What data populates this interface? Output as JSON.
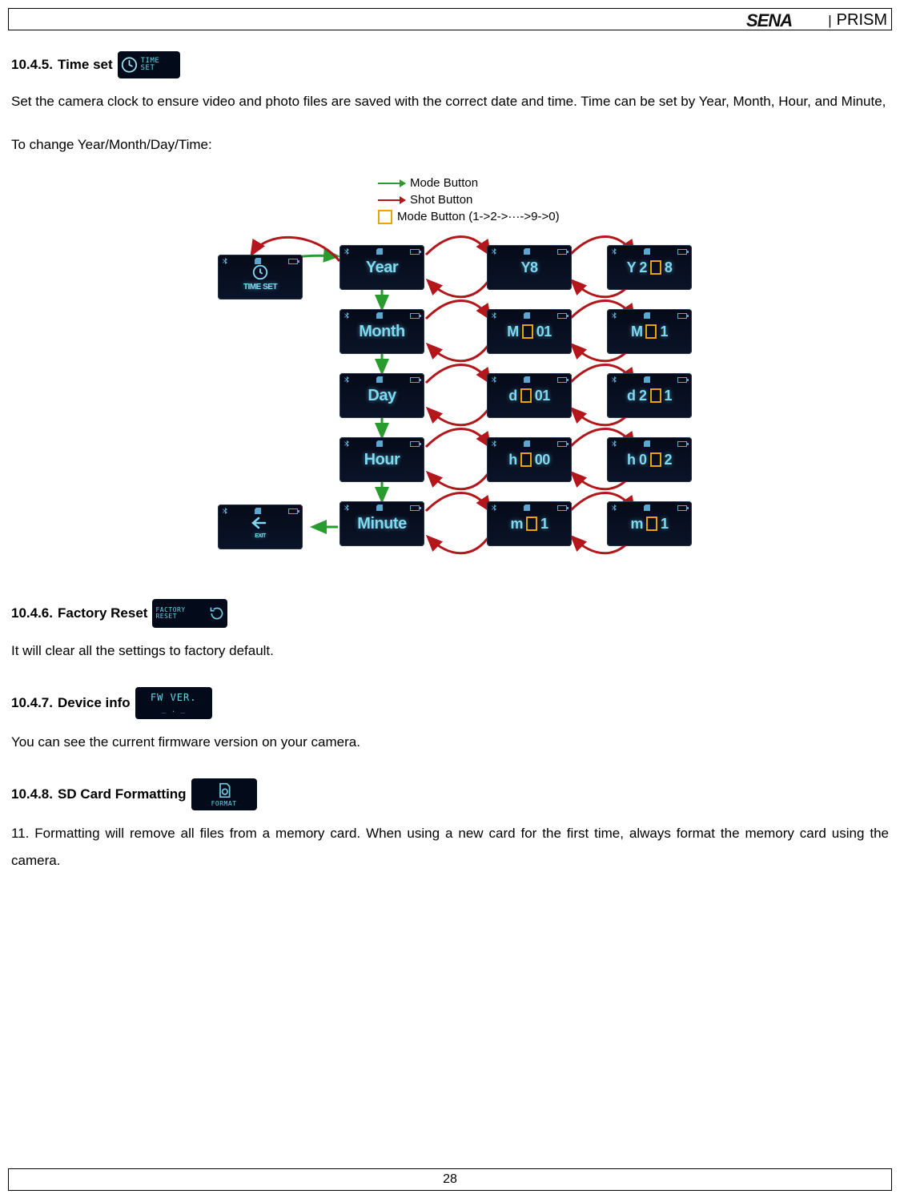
{
  "header": {
    "brand_divider": "|",
    "product": "PRISM"
  },
  "sec_time": {
    "num": "10.4.5.",
    "title": "Time set",
    "body": "Set the camera clock to ensure video and photo files are saved with the correct date and time. Time can be set by Year, Month, Hour, and Minute,",
    "sub": "To change Year/Month/Day/Time:",
    "chip_label": "TIME SET"
  },
  "diagram": {
    "legend": {
      "mode": "Mode Button",
      "shot": "Shot Button",
      "cycle": "Mode Button (1->2->···->9->0)"
    },
    "timeset_label": "TIME SET",
    "exit_label": "EXIT",
    "rows": [
      {
        "label": "Year",
        "mid": "Y",
        "mid_suffix": "8",
        "right": "Y 2",
        "right_suffix": "8"
      },
      {
        "label": "Month",
        "mid": "M",
        "mid_box": "0",
        "mid_suffix": "1",
        "right": "M  ",
        "right_box": "1"
      },
      {
        "label": "Day",
        "mid": "d",
        "mid_box": "0",
        "mid_suffix": "1",
        "right": "d 2",
        "right_box": "1"
      },
      {
        "label": "Hour",
        "mid": "h",
        "mid_box": "0",
        "mid_suffix": "0",
        "right": "h 0",
        "right_box": "2"
      },
      {
        "label": "Minute",
        "mid": "m",
        "mid_box": "",
        "mid_suffix": "1",
        "right": "m  ",
        "right_box": "1"
      }
    ]
  },
  "sec_factory": {
    "num": "10.4.6.",
    "title": "Factory Reset",
    "body": "It will clear all the settings to factory default.",
    "chip_label": "FACTORY RESET"
  },
  "sec_device": {
    "num": "10.4.7.",
    "title": "Device info",
    "body": "You can see the current firmware version on your camera.",
    "chip_label": "FW VER."
  },
  "sec_sd": {
    "num": "10.4.8.",
    "title": "SD Card Formatting",
    "body": "11. Formatting will remove all files from a memory card. When using a new card for the first time, always format the memory card using the camera.",
    "chip_label": "FORMAT"
  },
  "page_number": "28"
}
